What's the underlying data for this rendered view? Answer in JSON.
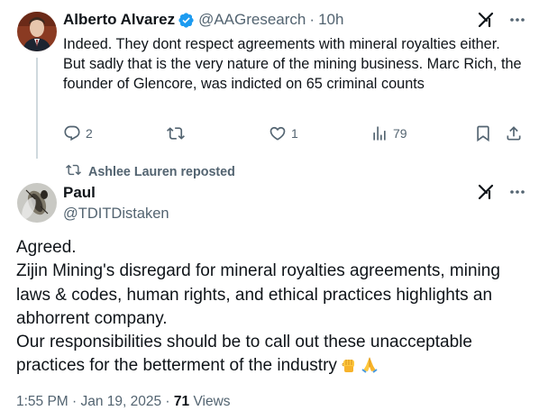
{
  "reply_tweet": {
    "author_name": "Alberto Alvarez",
    "handle": "@AAGresearch",
    "separator": "·",
    "time": "10h",
    "text_lines": [
      "Indeed. They dont respect agreements with mineral royalties either.",
      "But sadly that is the very nature of the mining business. Marc Rich, the founder of Glencore, was indicted on 65 criminal counts"
    ],
    "actions": {
      "replies": "2",
      "reposts": "",
      "likes": "1",
      "views": "79"
    }
  },
  "repost_banner": {
    "text": "Ashlee Lauren reposted"
  },
  "main_tweet": {
    "author_name": "Paul",
    "handle": "@TDITDistaken",
    "text_lines": [
      "Agreed.",
      "Zijin Mining's disregard for mineral royalties agreements, mining laws & codes, human rights, and ethical practices highlights an abhorrent company.",
      "Our responsibilities should be to call out these unacceptable practices for the betterment of the industry"
    ],
    "emojis": [
      "raised-fist-emoji",
      "folded-hands-emoji"
    ],
    "timestamp": "1:55 PM · Jan 19, 2025 ·",
    "views_count": "71",
    "views_label": "Views"
  },
  "colors": {
    "text_primary": "#0f1419",
    "text_secondary": "#536471",
    "verified_blue": "#1d9bf0",
    "thread_line": "#cfd9de",
    "emoji_yellow": "#ffc83d"
  },
  "icons": [
    "verified-badge-icon",
    "grok-icon",
    "more-icon",
    "reply-icon",
    "repost-icon",
    "like-icon",
    "views-icon",
    "bookmark-icon",
    "share-icon"
  ]
}
